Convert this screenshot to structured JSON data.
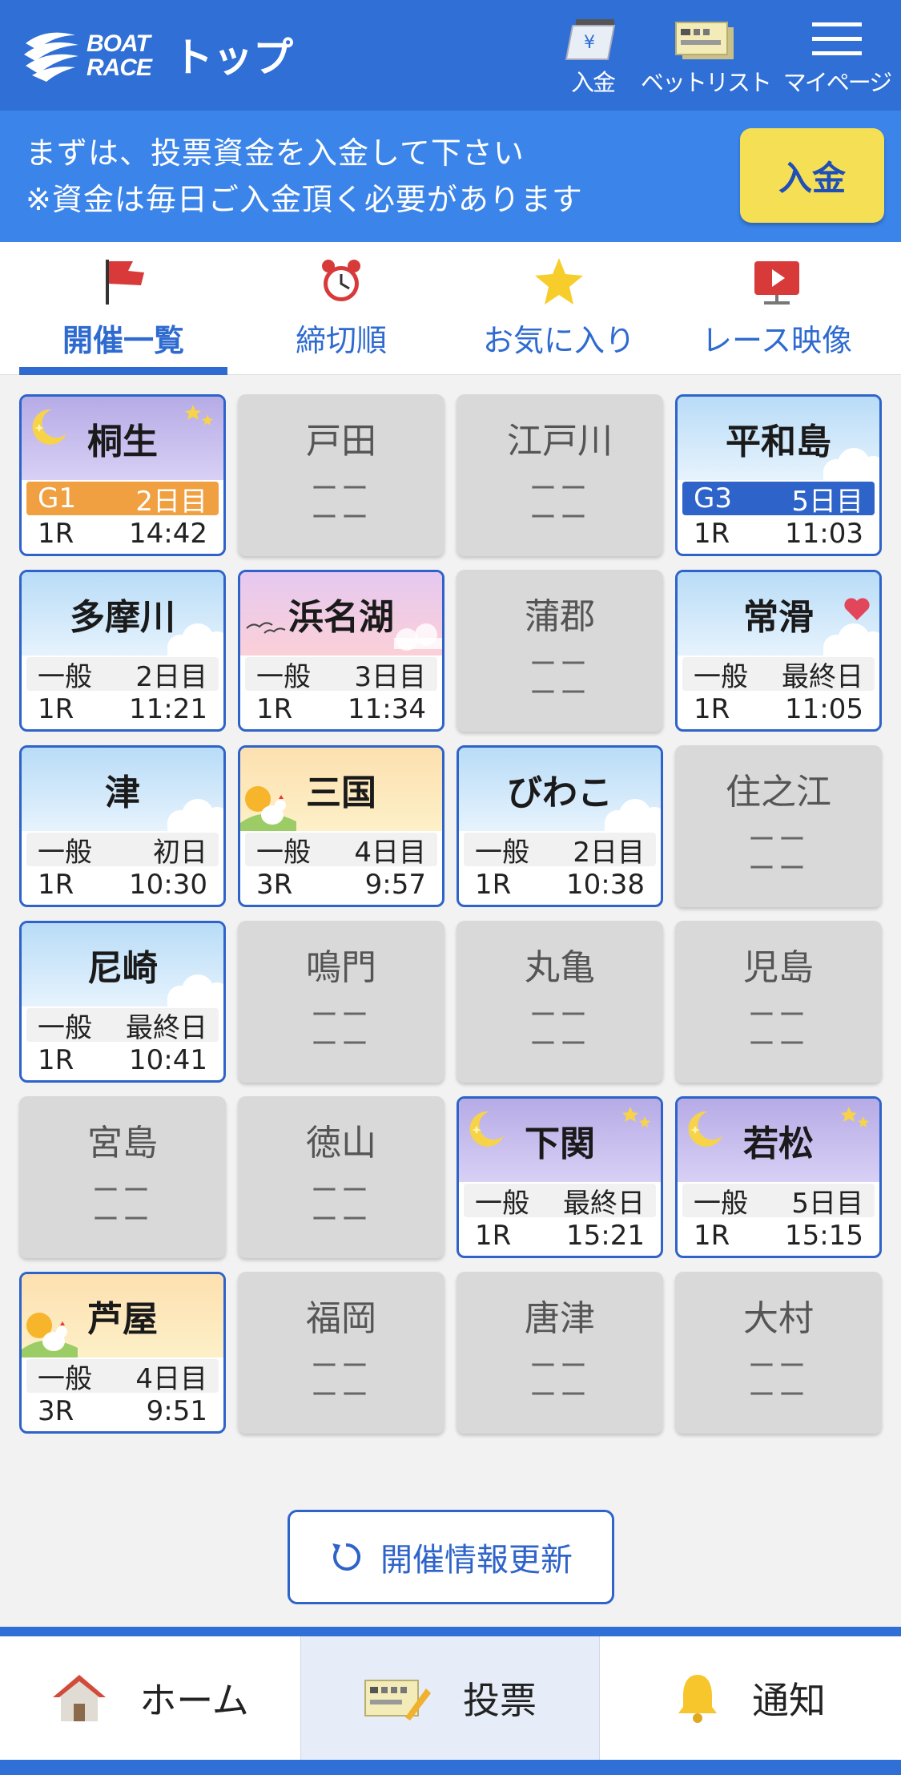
{
  "header": {
    "logo_text_1": "BOAT",
    "logo_text_2": "RACE",
    "title": "トップ",
    "buttons": [
      {
        "label": "入金",
        "icon": "yen-ticket-icon"
      },
      {
        "label": "ベットリスト",
        "icon": "ticket-list-icon"
      },
      {
        "label": "マイページ",
        "icon": "hamburger-menu-icon"
      }
    ]
  },
  "notice": {
    "line1": "まずは、投票資金を入金して下さい",
    "line2": "※資金は毎日ご入金頂く必要があります",
    "button": "入金"
  },
  "tabs": [
    {
      "label": "開催一覧",
      "icon": "flag-icon",
      "active": true
    },
    {
      "label": "締切順",
      "icon": "alarm-clock-icon"
    },
    {
      "label": "お気に入り",
      "icon": "star-icon"
    },
    {
      "label": "レース映像",
      "icon": "video-play-icon"
    }
  ],
  "venues": [
    {
      "name": "桐生",
      "grade": "G1",
      "day": "2日目",
      "race": "1R",
      "time": "14:42",
      "theme": "night"
    },
    {
      "name": "戸田",
      "dash": "ーー"
    },
    {
      "name": "江戸川",
      "dash": "ーー"
    },
    {
      "name": "平和島",
      "grade": "G3",
      "day": "5日目",
      "race": "1R",
      "time": "11:03",
      "theme": "day"
    },
    {
      "name": "多摩川",
      "grade": "一般",
      "day": "2日目",
      "race": "1R",
      "time": "11:21",
      "theme": "day"
    },
    {
      "name": "浜名湖",
      "grade": "一般",
      "day": "3日目",
      "race": "1R",
      "time": "11:34",
      "theme": "dusk"
    },
    {
      "name": "蒲郡",
      "dash": "ーー"
    },
    {
      "name": "常滑",
      "grade": "一般",
      "day": "最終日",
      "race": "1R",
      "time": "11:05",
      "theme": "day",
      "favorite": true
    },
    {
      "name": "津",
      "grade": "一般",
      "day": "初日",
      "race": "1R",
      "time": "10:30",
      "theme": "day"
    },
    {
      "name": "三国",
      "grade": "一般",
      "day": "4日目",
      "race": "3R",
      "time": "9:57",
      "theme": "morning"
    },
    {
      "name": "びわこ",
      "grade": "一般",
      "day": "2日目",
      "race": "1R",
      "time": "10:38",
      "theme": "day"
    },
    {
      "name": "住之江",
      "dash": "ーー"
    },
    {
      "name": "尼崎",
      "grade": "一般",
      "day": "最終日",
      "race": "1R",
      "time": "10:41",
      "theme": "day"
    },
    {
      "name": "鳴門",
      "dash": "ーー"
    },
    {
      "name": "丸亀",
      "dash": "ーー"
    },
    {
      "name": "児島",
      "dash": "ーー"
    },
    {
      "name": "宮島",
      "dash": "ーー"
    },
    {
      "name": "徳山",
      "dash": "ーー"
    },
    {
      "name": "下関",
      "grade": "一般",
      "day": "最終日",
      "race": "1R",
      "time": "15:21",
      "theme": "night"
    },
    {
      "name": "若松",
      "grade": "一般",
      "day": "5日目",
      "race": "1R",
      "time": "15:15",
      "theme": "night"
    },
    {
      "name": "芦屋",
      "grade": "一般",
      "day": "4日目",
      "race": "3R",
      "time": "9:51",
      "theme": "morning"
    },
    {
      "name": "福岡",
      "dash": "ーー"
    },
    {
      "name": "唐津",
      "dash": "ーー"
    },
    {
      "name": "大村",
      "dash": "ーー"
    }
  ],
  "refresh": {
    "label": "開催情報更新",
    "icon": "refresh-icon"
  },
  "bottom_nav": [
    {
      "label": "ホーム",
      "icon": "home-icon"
    },
    {
      "label": "投票",
      "icon": "ticket-pen-icon",
      "selected": true
    },
    {
      "label": "通知",
      "icon": "bell-icon"
    }
  ],
  "colors": {
    "header": "#2f6fd6",
    "notice": "#3b84ea",
    "accent": "#2e63c9",
    "deposit": "#f5df55",
    "g1": "#f0a040"
  }
}
